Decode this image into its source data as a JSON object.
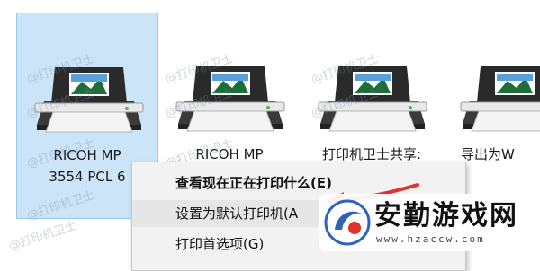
{
  "devices": [
    {
      "name": "RICOH MP\n3554 PCL 6",
      "selected": true
    },
    {
      "name": "RICOH MP",
      "selected": false
    },
    {
      "name": "打印机卫士共享:",
      "selected": false
    },
    {
      "name": "导出为W",
      "selected": false
    }
  ],
  "watermark": "@打印机卫士",
  "context_menu": {
    "items": [
      {
        "label": "查看现在正在打印什么(E)",
        "bold": true
      },
      {
        "label": "设置为默认打印机(A",
        "highlighted": true
      },
      {
        "label": "打印首选项(G)"
      }
    ]
  },
  "site_badge": {
    "title": "安勤游戏网",
    "url": "www.hzaccw.com"
  },
  "colors": {
    "selection": "#cce4f7",
    "arrow": "#e0322a",
    "badge_accent": "#2f63b8"
  }
}
